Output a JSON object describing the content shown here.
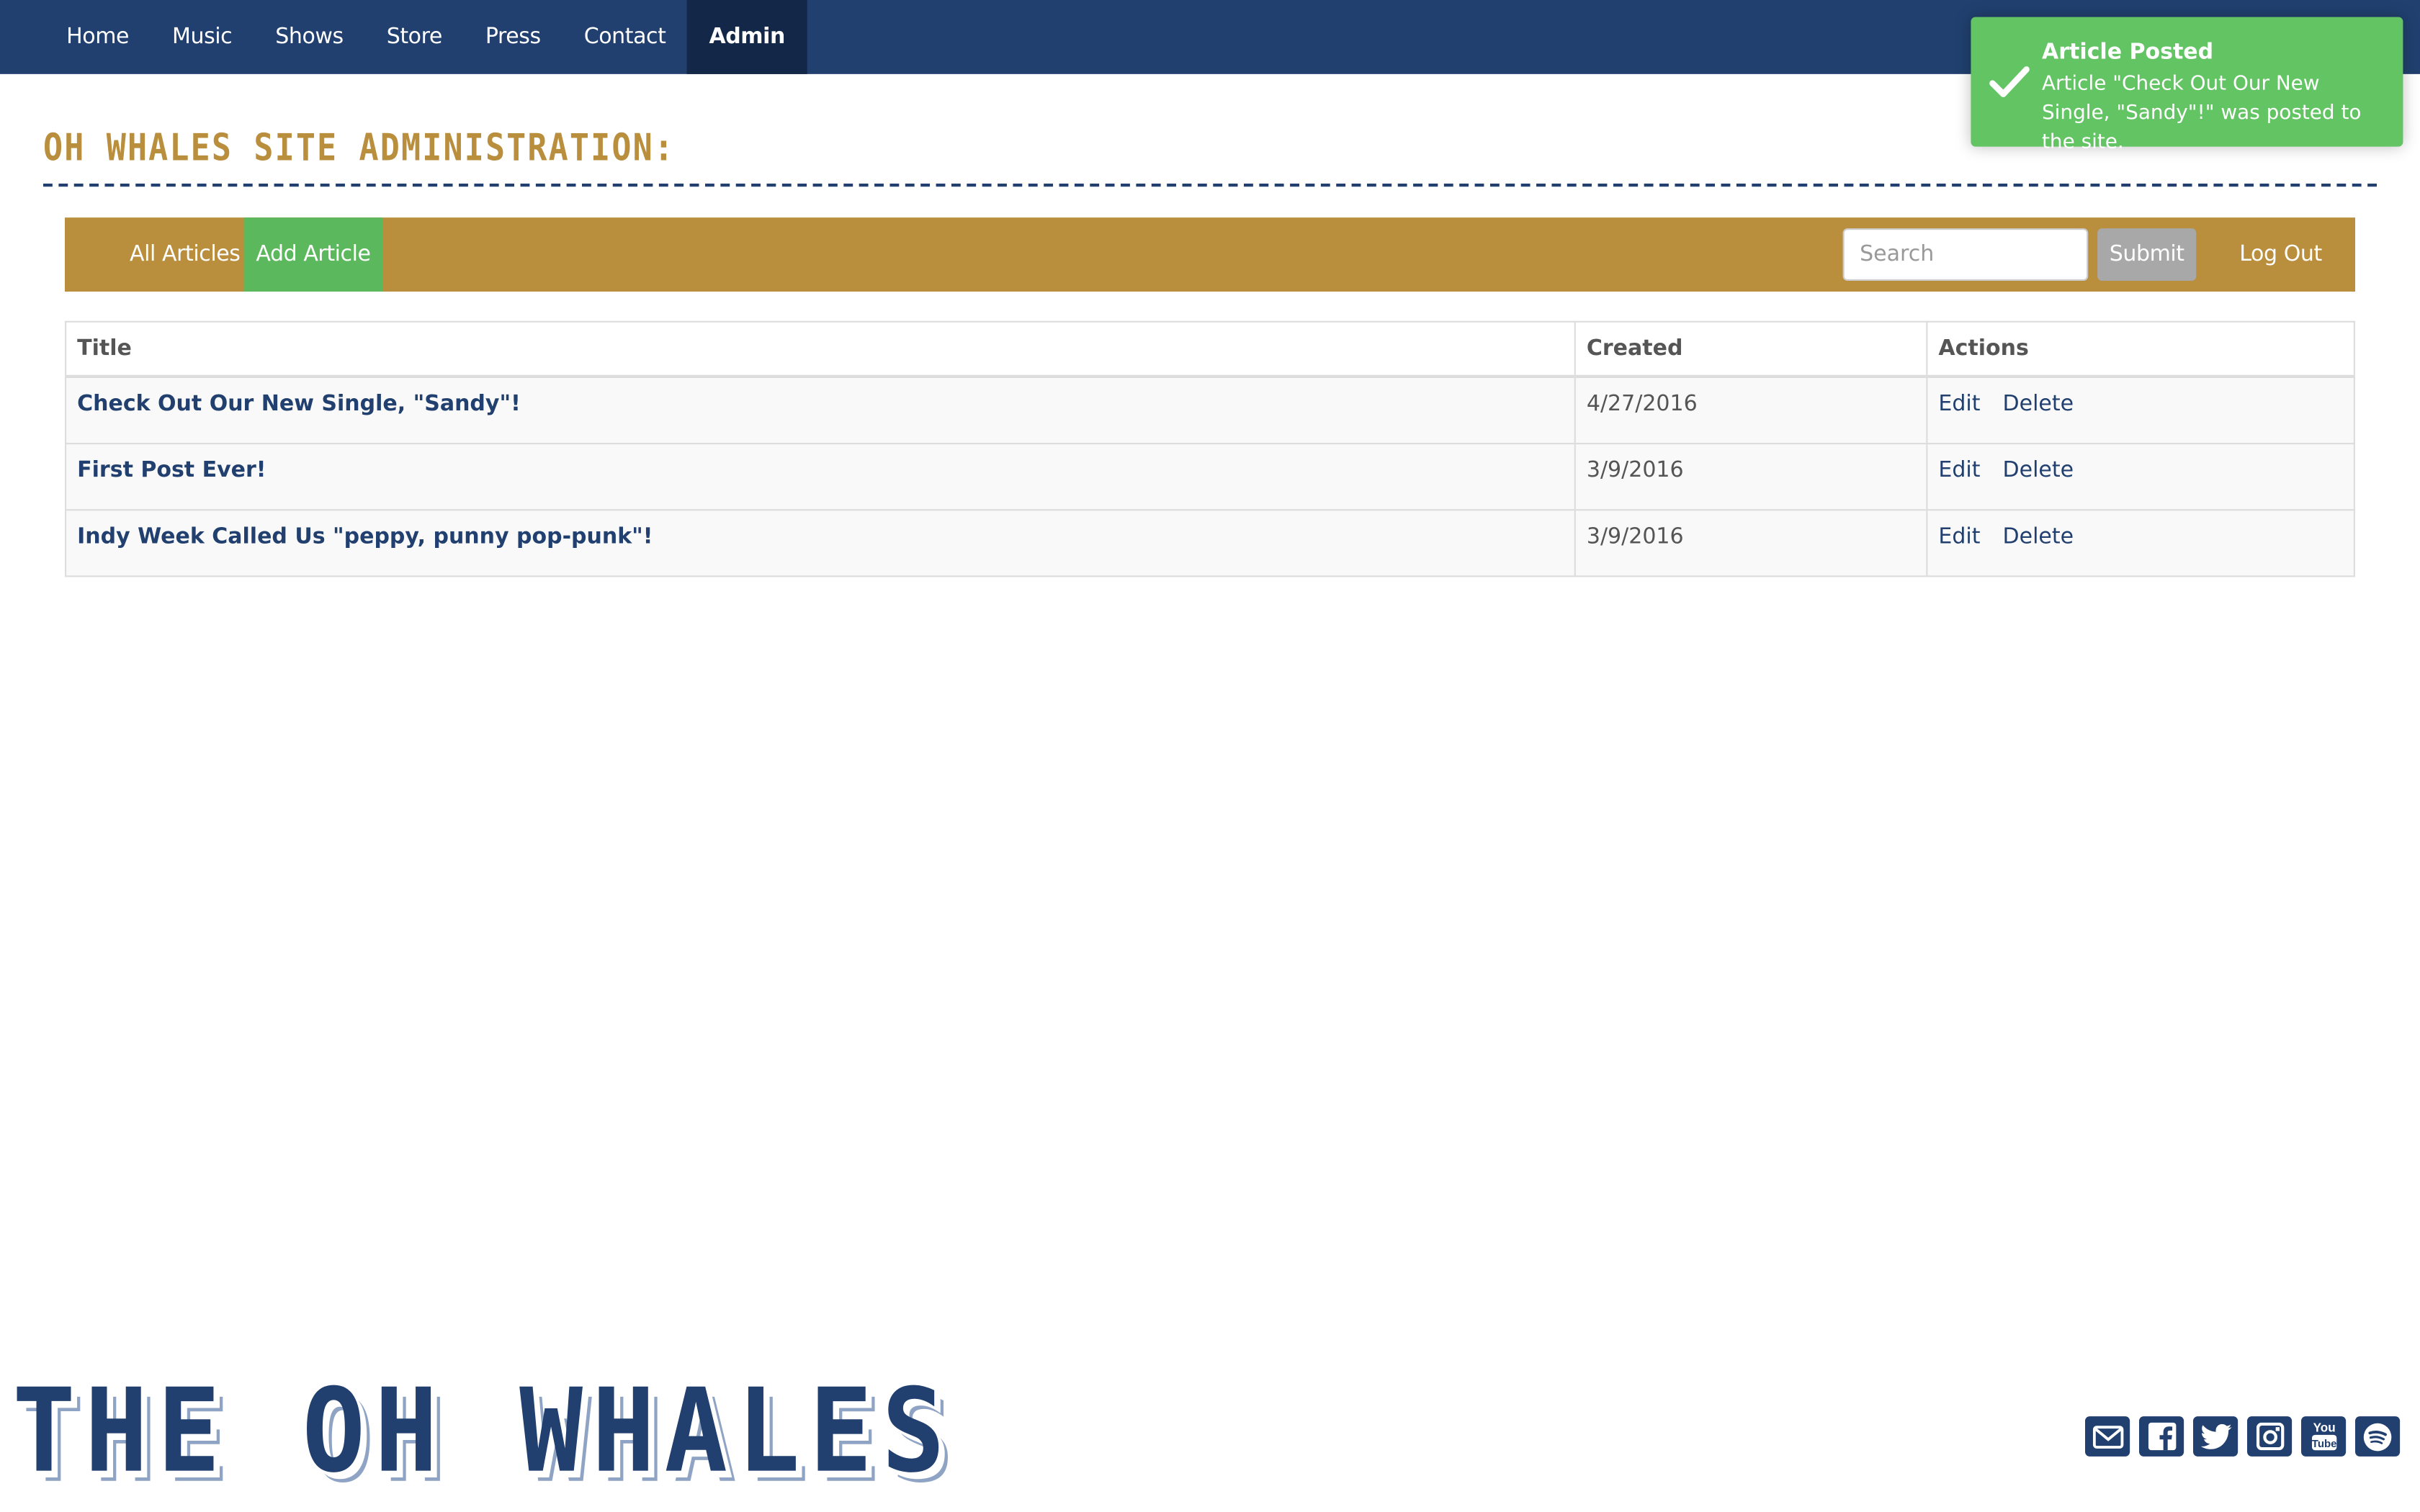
{
  "nav": {
    "items": [
      {
        "label": "Home"
      },
      {
        "label": "Music"
      },
      {
        "label": "Shows"
      },
      {
        "label": "Store"
      },
      {
        "label": "Press"
      },
      {
        "label": "Contact"
      },
      {
        "label": "Admin",
        "active": true
      }
    ]
  },
  "page_title": "OH WHALES SITE ADMINISTRATION:",
  "toolbar": {
    "all_articles": "All Articles",
    "add_article": "Add Article",
    "search_placeholder": "Search",
    "submit": "Submit",
    "logout": "Log Out"
  },
  "table": {
    "headers": [
      "Title",
      "Created",
      "Actions"
    ],
    "rows": [
      {
        "title": "Check Out Our New Single, \"Sandy\"!",
        "created": "4/27/2016",
        "edit": "Edit",
        "delete": "Delete"
      },
      {
        "title": "First Post Ever!",
        "created": "3/9/2016",
        "edit": "Edit",
        "delete": "Delete"
      },
      {
        "title": "Indy Week Called Us \"peppy, punny pop-punk\"!",
        "created": "3/9/2016",
        "edit": "Edit",
        "delete": "Delete"
      }
    ]
  },
  "toast": {
    "title": "Article Posted",
    "message": "Article \"Check Out Our New Single, \"Sandy\"!\" was posted to the site.",
    "icon": "check-icon"
  },
  "footer": {
    "logo_text": "THE OH WHALES",
    "social_icons": [
      "envelope-icon",
      "facebook-icon",
      "twitter-icon",
      "instagram-icon",
      "youtube-icon",
      "spotify-icon"
    ]
  },
  "colors": {
    "navy": "#21406f",
    "gold": "#b98e3d",
    "green": "#5cb85c",
    "toast_green": "#62c462"
  }
}
